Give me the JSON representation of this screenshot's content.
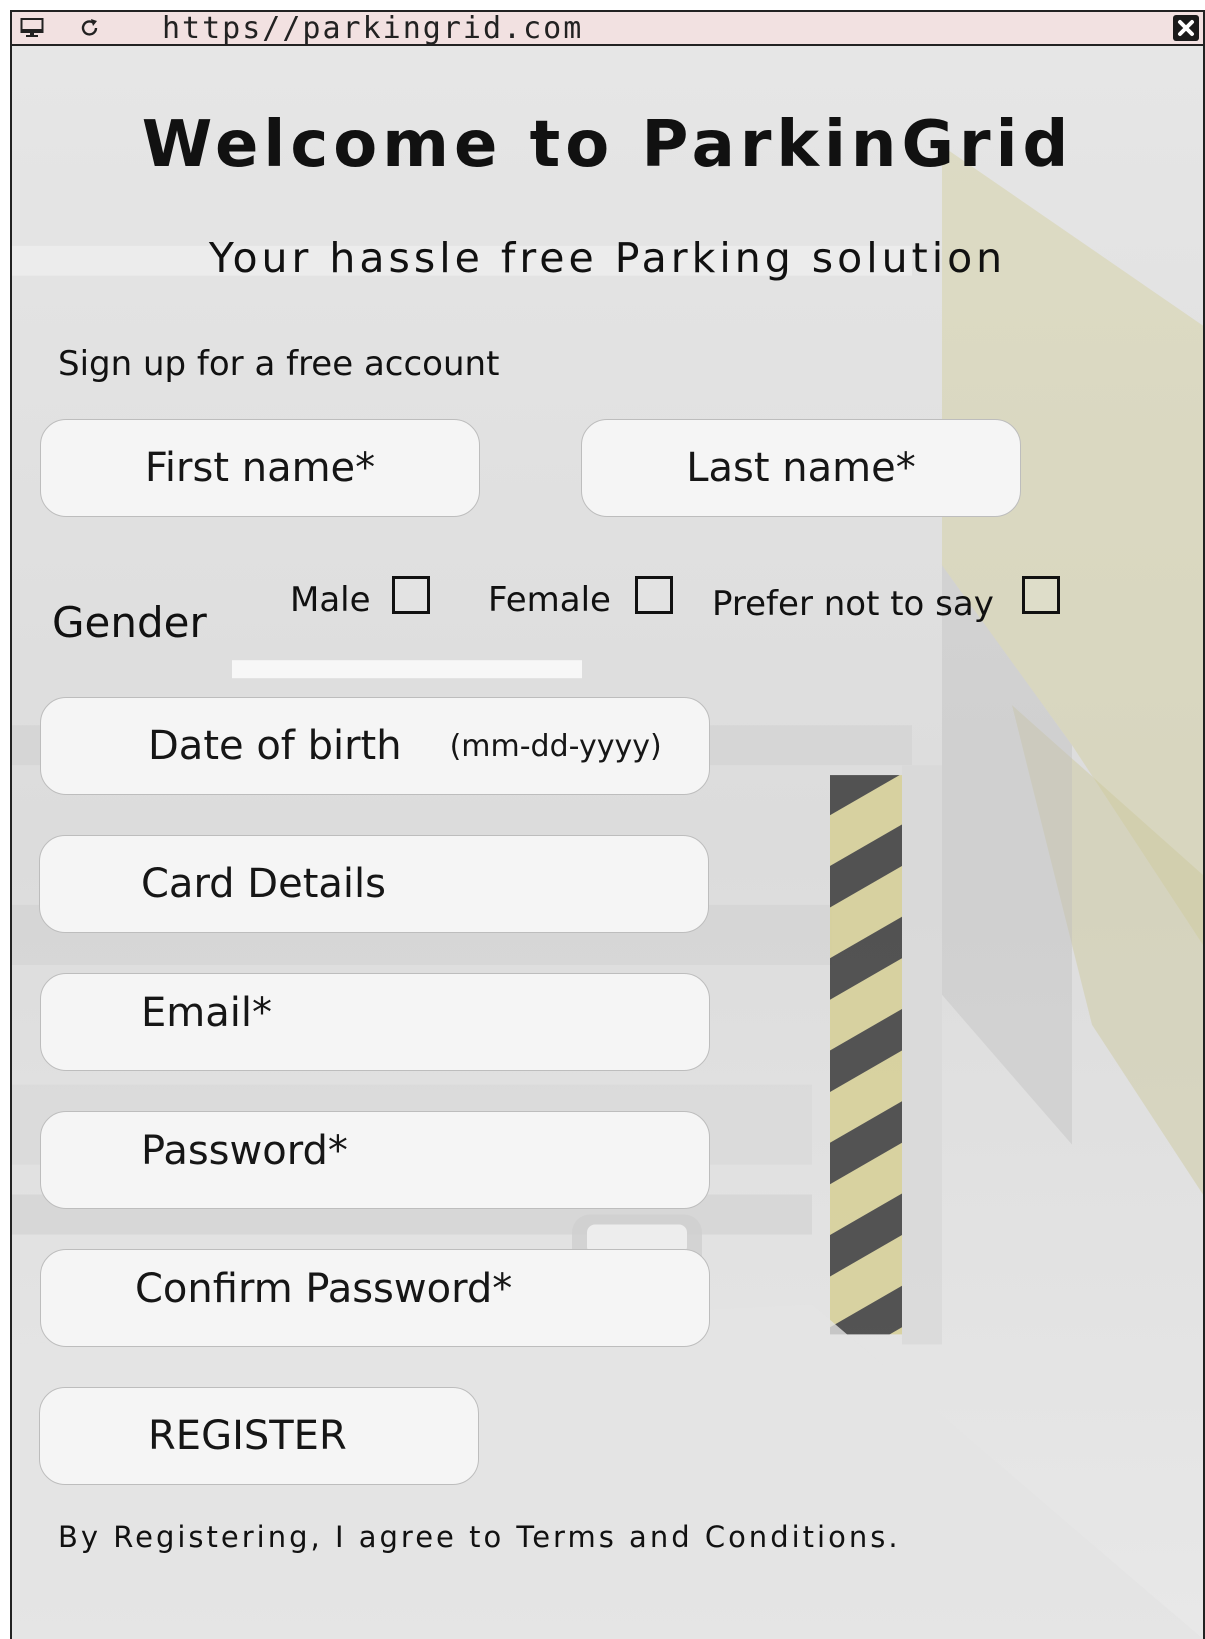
{
  "browser": {
    "url": "https//parkingrid.com",
    "monitor_icon": "monitor-icon",
    "reload_icon": "reload-icon",
    "close_icon": "close-icon"
  },
  "header": {
    "title": "Welcome to ParkinGrid",
    "subtitle": "Your hassle free Parking solution"
  },
  "form": {
    "heading": "Sign up for a free account",
    "first_name_placeholder": "First name*",
    "last_name_placeholder": "Last name*",
    "gender_label": "Gender",
    "gender_options": [
      {
        "label": "Male",
        "checked": false
      },
      {
        "label": "Female",
        "checked": false
      },
      {
        "label": "Prefer not to say",
        "checked": false
      }
    ],
    "dob_placeholder": "Date of birth",
    "dob_hint": "(mm-dd-yyyy)",
    "card_placeholder": "Card Details",
    "email_placeholder": "Email*",
    "password_placeholder": "Password*",
    "confirm_password_placeholder": "Confirm Password*",
    "register_label": "REGISTER",
    "terms_text": "By Registering, I agree to Terms and Conditions."
  },
  "colors": {
    "titlebar_bg": "#f2e1e1",
    "field_bg": "#f5f5f5",
    "stripe_yellow": "#d9d08a",
    "stripe_dark": "#2a2a2a"
  }
}
